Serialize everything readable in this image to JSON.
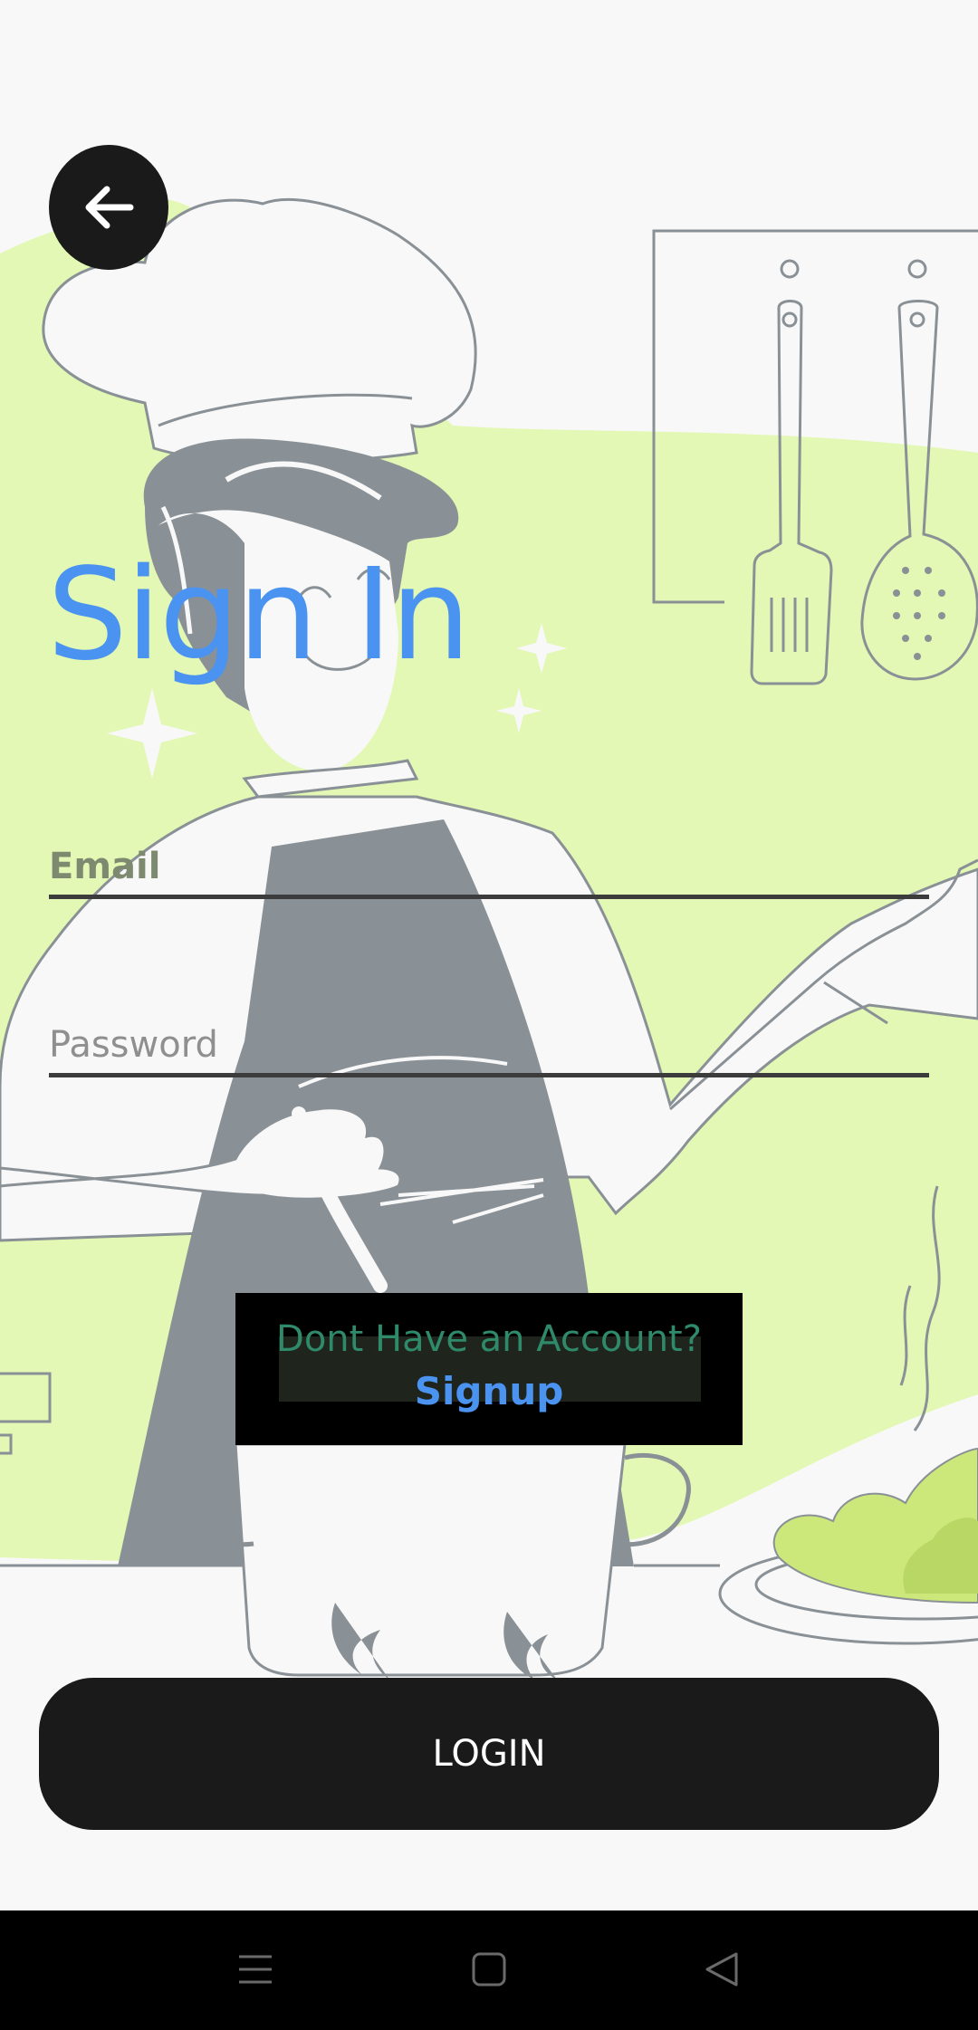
{
  "screen": {
    "title": "Sign In",
    "background_color": "#f8f8f8",
    "accent_color": "#4a93f0",
    "illustration": "chef-cooking-illustration"
  },
  "back_button": {
    "icon": "arrow-left-icon"
  },
  "form": {
    "email_placeholder": "Email",
    "email_value": "",
    "password_placeholder": "Password",
    "password_value": ""
  },
  "signup": {
    "prompt": "Dont Have an Account?",
    "link_label": "Signup"
  },
  "login_button": {
    "label": "LOGIN",
    "color": "#1a1a1a"
  },
  "nav_bar": {
    "icons": [
      "menu-icon",
      "home-square-icon",
      "back-triangle-icon"
    ]
  }
}
